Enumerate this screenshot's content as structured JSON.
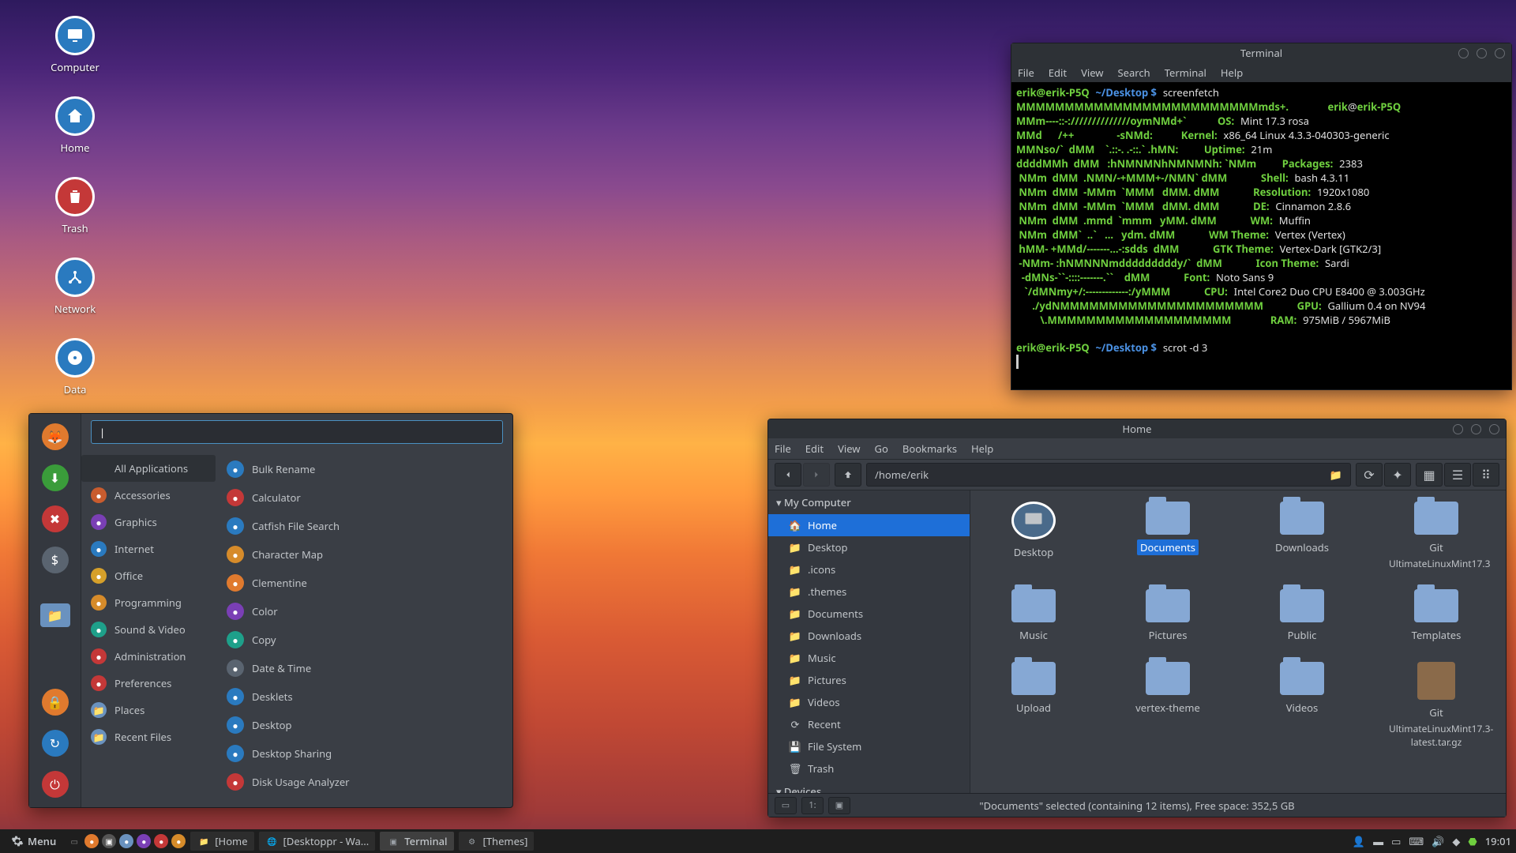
{
  "desktop_icons": [
    {
      "label": "Computer",
      "icon": "monitor"
    },
    {
      "label": "Home",
      "icon": "home"
    },
    {
      "label": "Trash",
      "icon": "trash"
    },
    {
      "label": "Network",
      "icon": "network"
    },
    {
      "label": "Data",
      "icon": "disk"
    }
  ],
  "terminal": {
    "title": "Terminal",
    "menu": [
      "File",
      "Edit",
      "View",
      "Search",
      "Terminal",
      "Help"
    ],
    "prompt_user": "erik",
    "prompt_host": "erik-P5Q",
    "prompt_path": "~/Desktop",
    "cmd1": "screenfetch",
    "cmd2": "scrot -d 3",
    "info": {
      "user_at_host": "erik@erik-P5Q",
      "OS": "Mint 17.3 rosa",
      "Kernel": "x86_64 Linux 4.3.3-040303-generic",
      "Uptime": "21m",
      "Packages": "2383",
      "Shell": "bash 4.3.11",
      "Resolution": "1920x1080",
      "DE": "Cinnamon 2.8.6",
      "WM": "Muffin",
      "WM_Theme": "Vertex (Vertex)",
      "GTK_Theme": "Vertex-Dark [GTK2/3]",
      "Icon_Theme": "Sardi",
      "Font": "Noto Sans 9",
      "CPU": "Intel Core2 Duo CPU E8400 @ 3.003GHz",
      "GPU": "Gallium 0.4 on NV94",
      "RAM": "975MiB / 5967MiB"
    },
    "ascii": [
      "MMMMMMMMMMMMMMMMMMMMMMMMMmds+.      ",
      "MMm----::-://////////////oymNMd+`   ",
      "MMd      /++                -sNMd:  ",
      "MMNso/`  dMM    `.::-. .-::.` .hMN: ",
      "ddddMMh  dMM   :hNMNMNhNMNMNh: `NMm ",
      " NMm  dMM  .NMN/-+MMM+-/NMN` dMM ",
      " NMm  dMM  -MMm  `MMM   dMM. dMM ",
      " NMm  dMM  -MMm  `MMM   dMM. dMM ",
      " NMm  dMM  .mmd  `mmm   yMM. dMM ",
      " NMm  dMM`  ..`   ...   ydm. dMM ",
      " hMM- +MMd/-------...-:sdds  dMM ",
      " -NMm- :hNMNNNmdddddddddy/`  dMM ",
      "  -dMNs-``-::::-------.``    dMM ",
      "   `/dMNmy+/:-------------:/yMMM ",
      "      ./ydNMMMMMMMMMMMMMMMMMMMMM ",
      "         \\.MMMMMMMMMMMMMMMMMMM   "
    ]
  },
  "fileman": {
    "title": "Home",
    "menu": [
      "File",
      "Edit",
      "View",
      "Go",
      "Bookmarks",
      "Help"
    ],
    "path": "/home/erik",
    "sidebar": {
      "section1": "My Computer",
      "items1": [
        {
          "label": "Home",
          "icon": "home",
          "active": true
        },
        {
          "label": "Desktop",
          "icon": "folder"
        },
        {
          "label": ".icons",
          "icon": "folder"
        },
        {
          "label": ".themes",
          "icon": "folder"
        },
        {
          "label": "Documents",
          "icon": "folder"
        },
        {
          "label": "Downloads",
          "icon": "folder"
        },
        {
          "label": "Music",
          "icon": "folder"
        },
        {
          "label": "Pictures",
          "icon": "folder"
        },
        {
          "label": "Videos",
          "icon": "folder"
        },
        {
          "label": "Recent",
          "icon": "recent"
        },
        {
          "label": "File System",
          "icon": "disk"
        },
        {
          "label": "Trash",
          "icon": "trash"
        }
      ],
      "section2": "Devices"
    },
    "items": [
      {
        "label": "Desktop",
        "sub": "",
        "icon": "desktop"
      },
      {
        "label": "Documents",
        "sub": "",
        "icon": "folder",
        "selected": true
      },
      {
        "label": "Downloads",
        "sub": "",
        "icon": "folder"
      },
      {
        "label": "Git",
        "sub": "UltimateLinuxMint17.3",
        "icon": "folder"
      },
      {
        "label": "Music",
        "sub": "",
        "icon": "folder"
      },
      {
        "label": "Pictures",
        "sub": "",
        "icon": "folder"
      },
      {
        "label": "Public",
        "sub": "",
        "icon": "folder"
      },
      {
        "label": "Templates",
        "sub": "",
        "icon": "folder"
      },
      {
        "label": "Upload",
        "sub": "",
        "icon": "folder"
      },
      {
        "label": "vertex-theme",
        "sub": "",
        "icon": "folder"
      },
      {
        "label": "Videos",
        "sub": "",
        "icon": "folder"
      },
      {
        "label": "Git",
        "sub": "UltimateLinuxMint17.3-latest.tar.gz",
        "icon": "archive"
      }
    ],
    "status": "\"Documents\" selected (containing 12 items), Free space: 352,5 GB"
  },
  "startmenu": {
    "search_value": "|",
    "categories": [
      {
        "label": "All Applications",
        "color": "#555",
        "active": true
      },
      {
        "label": "Accessories",
        "color": "#c95c2e"
      },
      {
        "label": "Graphics",
        "color": "#7a3fb5"
      },
      {
        "label": "Internet",
        "color": "#2a7abf"
      },
      {
        "label": "Office",
        "color": "#d6a02a"
      },
      {
        "label": "Programming",
        "color": "#d68b2a"
      },
      {
        "label": "Sound & Video",
        "color": "#1ea08a"
      },
      {
        "label": "Administration",
        "color": "#c43838"
      },
      {
        "label": "Preferences",
        "color": "#c43838"
      },
      {
        "label": "Places",
        "color": "#6a92bf"
      },
      {
        "label": "Recent Files",
        "color": "#6a92bf"
      }
    ],
    "apps": [
      {
        "label": "Bulk Rename",
        "color": "#2a7abf"
      },
      {
        "label": "Calculator",
        "color": "#c43838"
      },
      {
        "label": "Catfish File Search",
        "color": "#2a7abf"
      },
      {
        "label": "Character Map",
        "color": "#d68b2a"
      },
      {
        "label": "Clementine",
        "color": "#e07a2e"
      },
      {
        "label": "Color",
        "color": "#7a3fb5"
      },
      {
        "label": "Copy",
        "color": "#1ea08a"
      },
      {
        "label": "Date & Time",
        "color": "#5a6470"
      },
      {
        "label": "Desklets",
        "color": "#2a7abf"
      },
      {
        "label": "Desktop",
        "color": "#2a7abf"
      },
      {
        "label": "Desktop Sharing",
        "color": "#2a7abf"
      },
      {
        "label": "Disk Usage Analyzer",
        "color": "#c43838"
      }
    ],
    "launchers": [
      {
        "name": "firefox",
        "color": "#e07a2e"
      },
      {
        "name": "download",
        "color": "#3a9c3a"
      },
      {
        "name": "tools",
        "color": "#c43838"
      },
      {
        "name": "software",
        "color": "#5a6470"
      },
      {
        "name": "files",
        "color": "#6a92bf"
      },
      {
        "name": "lock",
        "color": "#e07a2e"
      },
      {
        "name": "logout",
        "color": "#2a7abf"
      },
      {
        "name": "power",
        "color": "#c43838"
      }
    ]
  },
  "taskbar": {
    "menu_label": "Menu",
    "quick": [
      {
        "name": "show-desktop",
        "glyph": "▭",
        "color": "#888"
      },
      {
        "name": "firefox",
        "glyph": "●",
        "color": "#e07a2e"
      },
      {
        "name": "terminal",
        "glyph": "▣",
        "color": "#555"
      },
      {
        "name": "files2",
        "glyph": "●",
        "color": "#6a92bf"
      },
      {
        "name": "app1",
        "glyph": "●",
        "color": "#7a3fb5"
      },
      {
        "name": "app2",
        "glyph": "●",
        "color": "#c43838"
      },
      {
        "name": "app3",
        "glyph": "●",
        "color": "#d68b2a"
      }
    ],
    "tasks": [
      {
        "label": "[Home",
        "icon": "folder",
        "active": false
      },
      {
        "label": "[Desktoppr - Wa...",
        "icon": "web",
        "active": false
      },
      {
        "label": "Terminal",
        "icon": "terminal",
        "active": true
      },
      {
        "label": "[Themes]",
        "icon": "settings",
        "active": false
      }
    ],
    "clock": "19:01"
  }
}
